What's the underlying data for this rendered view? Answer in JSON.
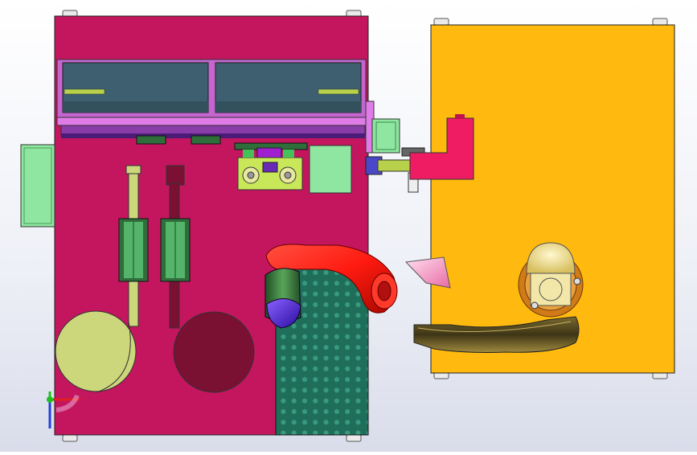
{
  "viewport": {
    "background_top": "#ffffff",
    "background_bottom": "#d9dcea"
  },
  "colors": {
    "magenta_plate": "#c4165f",
    "yellow_plate": "#ffb90f",
    "tray_glass": "#3e5f6f",
    "rail_purple": "#8a3ca8",
    "light_green": "#8fe6a0",
    "lime": "#ccd67a",
    "maroon": "#7a1032",
    "teal_grid": "#1f6e5a",
    "robot_red": "#ff1a10",
    "robot_green": "#3d7d3f",
    "robot_blue": "#5a2cd6",
    "pink_block": "#f01c63",
    "olive_arm": "#4f4620",
    "cream_cup": "#f2e7a8",
    "orange_ring": "#d07a18"
  },
  "parts": {
    "left_base_plate": "magenta-base-plate",
    "right_base_plate": "yellow-base-plate",
    "robot_arm": "red-robot-arm",
    "perforated_table": "perforated-fixture-table",
    "suction_cup": "suction-cup-assembly",
    "olive_arm": "olive-gripper-arm"
  },
  "triad": {
    "x_axis_color": "#e02020",
    "y_axis_color": "#20c020",
    "z_axis_color": "#2040e0"
  }
}
